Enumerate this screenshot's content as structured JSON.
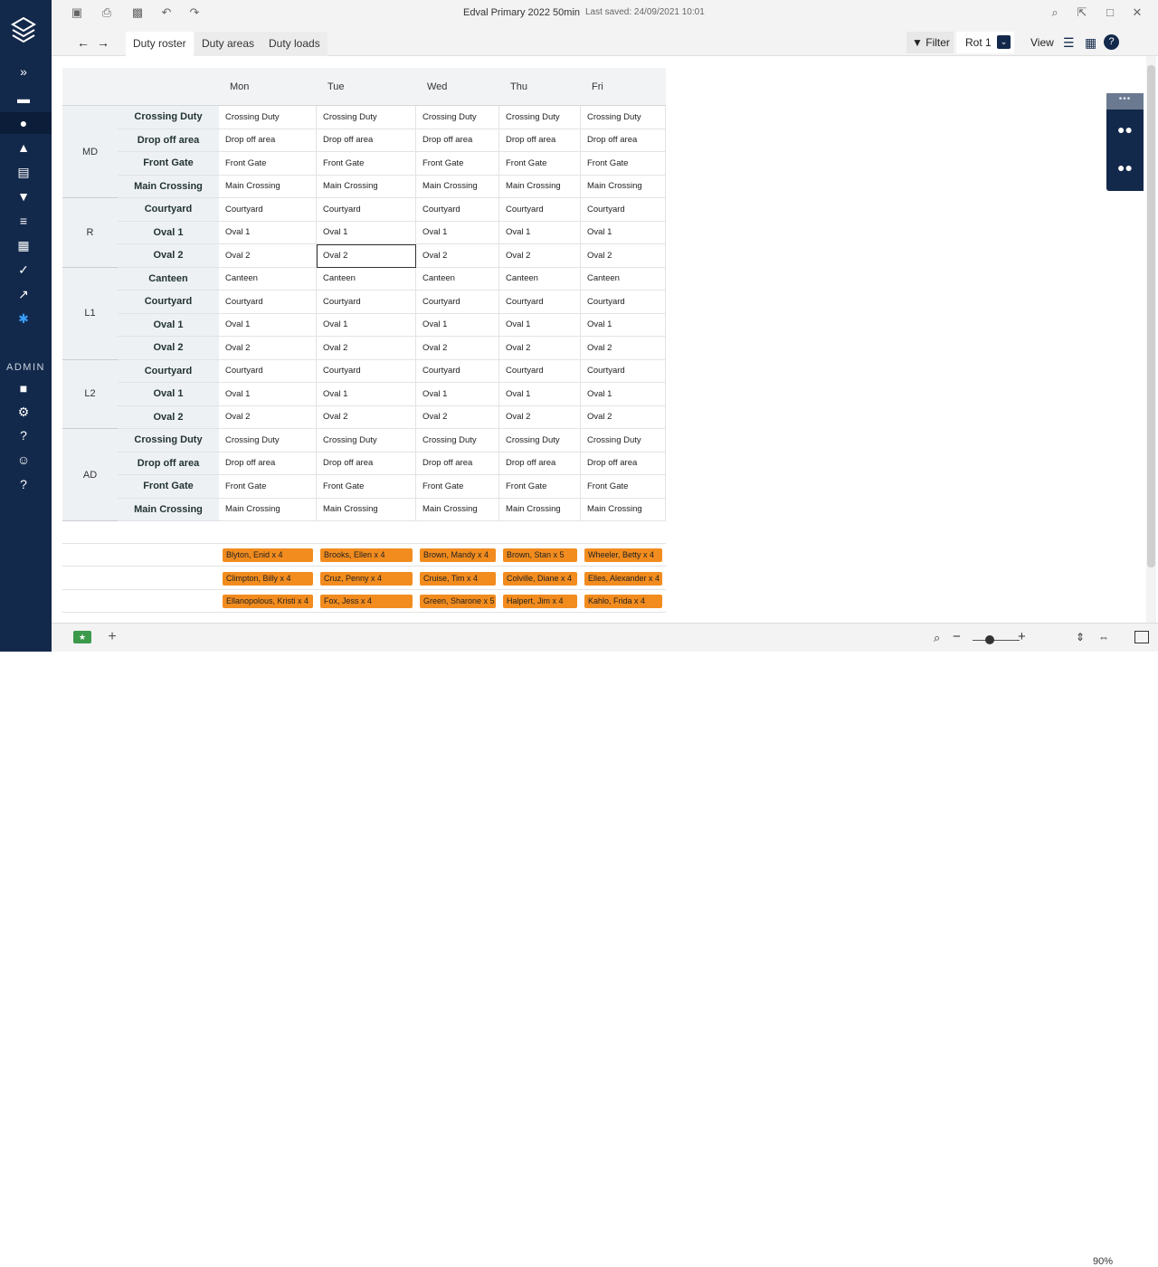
{
  "app": {
    "title": "Edval Primary 2022 50min",
    "last_saved": "Last saved: 24/09/2021 10:01"
  },
  "colors": {
    "sidebar": "#13294b",
    "chip": "#f28c1e",
    "header": "#f1f3f5"
  },
  "sidebar": {
    "admin_label": "ADMIN",
    "icons": [
      "expand-icon",
      "box-icon",
      "person-icon",
      "stamp-icon",
      "book-icon",
      "graduation-icon",
      "bars-icon",
      "grid-icon",
      "check-badge-icon",
      "trend-icon",
      "gear-bug-icon",
      "lock-icon",
      "settings-icon",
      "help-icon",
      "chat-icon",
      "question-icon"
    ]
  },
  "tabs": {
    "duty_roster": "Duty roster",
    "duty_areas": "Duty areas",
    "duty_loads": "Duty loads"
  },
  "toolbar": {
    "filter": "Filter",
    "rot": "Rot 1",
    "view": "View"
  },
  "days": [
    "Mon",
    "Tue",
    "Wed",
    "Thu",
    "Fri"
  ],
  "groups": [
    {
      "name": "MD",
      "rows": [
        "Crossing Duty",
        "Drop off area",
        "Front Gate",
        "Main Crossing"
      ]
    },
    {
      "name": "R",
      "rows": [
        "Courtyard",
        "Oval 1",
        "Oval 2"
      ]
    },
    {
      "name": "L1",
      "rows": [
        "Canteen",
        "Courtyard",
        "Oval 1",
        "Oval 2"
      ]
    },
    {
      "name": "L2",
      "rows": [
        "Courtyard",
        "Oval 1",
        "Oval 2"
      ]
    },
    {
      "name": "AD",
      "rows": [
        "Crossing Duty",
        "Drop off area",
        "Front Gate",
        "Main Crossing"
      ]
    }
  ],
  "staff": [
    [
      "Blyton, Enid x 4",
      "Brooks, Ellen x 4",
      "Brown, Mandy x 4",
      "Brown, Stan x 5",
      "Wheeler, Betty x 4"
    ],
    [
      "Climpton, Billy x 4",
      "Cruz, Penny x 4",
      "Cruise, Tim x 4",
      "Colville, Diane x 4",
      "Elles, Alexander x 4"
    ],
    [
      "Ellanopolous, Kristi x 4",
      "Fox, Jess x 4",
      "Green, Sharone x 5",
      "Halpert, Jim x 4",
      "Kahlo, Frida x 4"
    ]
  ],
  "zoom": {
    "level": "90%"
  }
}
